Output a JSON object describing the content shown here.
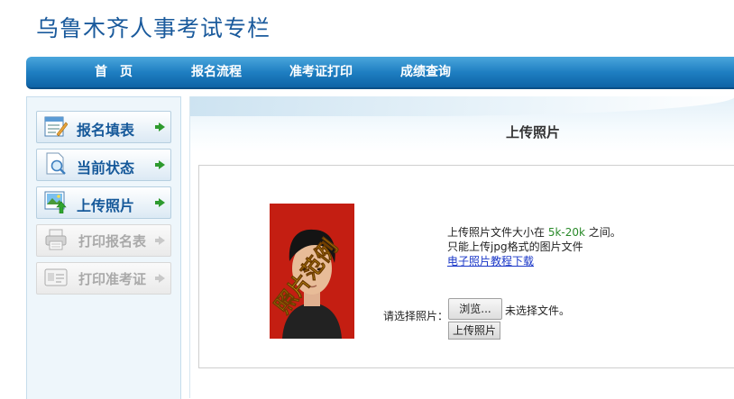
{
  "site": {
    "title": "乌鲁木齐人事考试专栏"
  },
  "nav": {
    "items": [
      "首　页",
      "报名流程",
      "准考证打印",
      "成绩查询"
    ]
  },
  "sidebar": {
    "items": [
      {
        "label": "报名填表",
        "icon": "form-icon",
        "enabled": true
      },
      {
        "label": "当前状态",
        "icon": "status-search-icon",
        "enabled": true
      },
      {
        "label": "上传照片",
        "icon": "upload-photo-icon",
        "enabled": true
      },
      {
        "label": "打印报名表",
        "icon": "printer-icon",
        "enabled": false
      },
      {
        "label": "打印准考证",
        "icon": "id-card-icon",
        "enabled": false
      }
    ]
  },
  "content": {
    "title": "上传照片",
    "photo": {
      "watermark": "照片范例"
    },
    "info": {
      "line1_prefix": "上传照片文件大小在 ",
      "line1_size": "5k-20k",
      "line1_suffix": " 之间。",
      "line2": "只能上传jpg格式的图片文件",
      "link": "电子照片教程下载"
    },
    "form": {
      "choose_label": "请选择照片：",
      "browse_button": "浏览...",
      "no_file_text": "未选择文件。",
      "upload_button": "上传照片"
    }
  },
  "colors": {
    "nav_bg": "#1f7fc2",
    "title_blue": "#1a5a9c",
    "sidebar_bg": "#eef6fb",
    "photo_bg": "#c41e12",
    "highlight_green": "#2a8a2a"
  }
}
